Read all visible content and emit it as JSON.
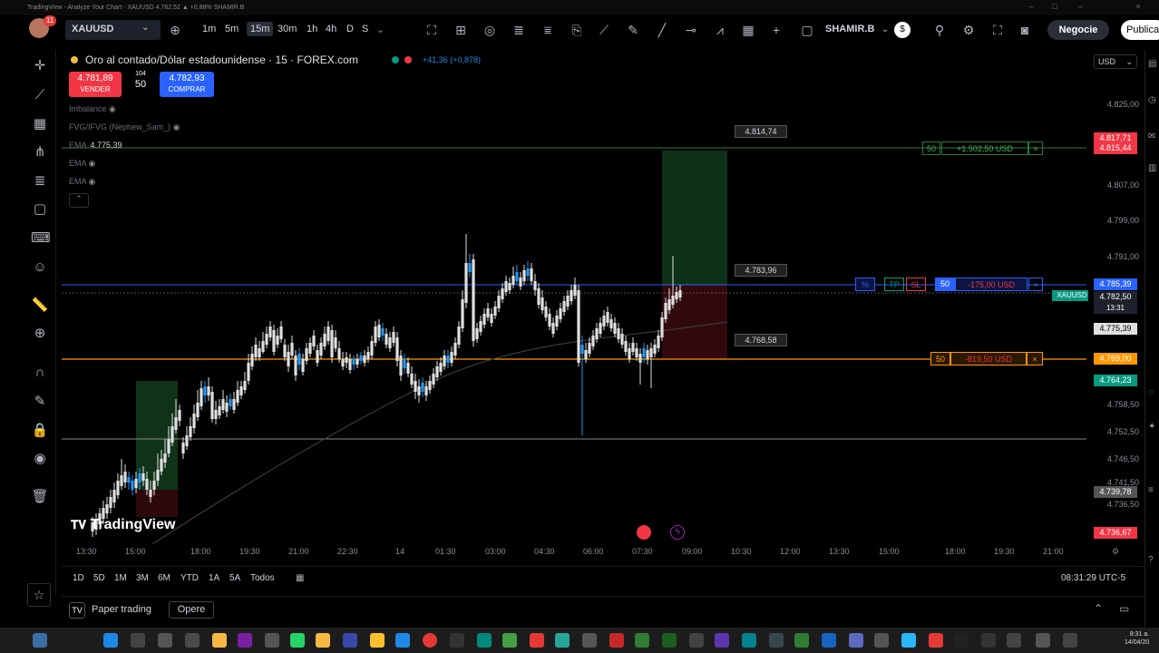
{
  "window": {
    "title": "TradingView - Analyze Your Chart - XAUUSD 4.782,52 ▲ +0,88% SHAMIR.B"
  },
  "topbar": {
    "avatar_badge": "11",
    "symbol": "XAUUSD",
    "timeframes": [
      "1m",
      "5m",
      "15m",
      "30m",
      "1h",
      "4h",
      "D",
      "S"
    ],
    "active_timeframe": "15m",
    "user": "SHAMIR.B",
    "trade_label": "Negocie",
    "publish_label": "Publica"
  },
  "legend": {
    "title": "Oro al contado/Dólar estadounidense · 15 · FOREX.com",
    "change": "+41,36 (+0,878)",
    "sell_price": "4.781,89",
    "sell_label": "VENDER",
    "spread": "104",
    "quantity": "50",
    "buy_price": "4.782,93",
    "buy_label": "COMPRAR",
    "indicators": [
      {
        "name": "Imbalance",
        "value": ""
      },
      {
        "name": "FVG/IFVG (Nephew_Sam_)",
        "value": ""
      },
      {
        "name": "EMA",
        "value": "4.775,39"
      },
      {
        "name": "EMA",
        "value": ""
      },
      {
        "name": "EMA",
        "value": ""
      }
    ]
  },
  "price_axis": {
    "currency": "USD",
    "ticks": [
      "4.825,00",
      "4.807,00",
      "4.799,00",
      "4.791,00",
      "4.758,50",
      "4.752,50",
      "4.746,50",
      "4.741,50",
      "4.736,50"
    ],
    "tags": [
      {
        "text": "4.817,71",
        "color": "#f23645"
      },
      {
        "text": "4.815,44",
        "color": "#f23645"
      },
      {
        "text": "4.785,39",
        "color": "#2962ff"
      },
      {
        "text": "4.782,50",
        "color": "#1e222d"
      },
      {
        "text": "13:31",
        "color": "#1e222d"
      },
      {
        "text": "4.775,39",
        "color": "#e0e0e0"
      },
      {
        "text": "4.769,00",
        "color": "#ff9800"
      },
      {
        "text": "4.764,23",
        "color": "#089981"
      },
      {
        "text": "4.739,78",
        "color": "#555555"
      },
      {
        "text": "4.736,67",
        "color": "#f23645"
      }
    ],
    "symbol_tag": "XAUUSD"
  },
  "position": {
    "target_label": "4.814,74",
    "entry_label": "4.783,96",
    "stop_label": "4.768,58",
    "tp_line": {
      "qty": "50",
      "text": "+1.502,50 USD"
    },
    "entry_line": {
      "qty": "50",
      "text": "-175,00 USD",
      "tp": "TP",
      "sl": "SL",
      "pct": "%"
    },
    "sl_line": {
      "qty": "50",
      "text": "-819,50 USD"
    }
  },
  "time_axis": {
    "ticks": [
      "13:30",
      "15:00",
      "18:00",
      "19:30",
      "21:00",
      "22:30",
      "14",
      "01:30",
      "03:00",
      "04:30",
      "06:00",
      "07:30",
      "09:00",
      "10:30",
      "12:00",
      "13:30",
      "15:00",
      "18:00",
      "19:30",
      "21:00"
    ]
  },
  "range_bar": {
    "ranges": [
      "1D",
      "5D",
      "1M",
      "3M",
      "6M",
      "YTD",
      "1A",
      "5A",
      "Todos"
    ],
    "clock": "08:31:29 UTC-5"
  },
  "bottom_panel": {
    "paper_trading": "Paper trading",
    "open_label": "Opere"
  },
  "branding": {
    "logo_text": "TradingView"
  },
  "taskbar": {
    "time": "8:31 a.",
    "date": "14/04/20"
  },
  "candles": [
    [
      100,
      576,
      586,
      570,
      592
    ],
    [
      104,
      572,
      584,
      566,
      590
    ],
    [
      108,
      566,
      578,
      560,
      584
    ],
    [
      112,
      560,
      572,
      552,
      578
    ],
    [
      116,
      556,
      566,
      548,
      572
    ],
    [
      120,
      548,
      560,
      540,
      566
    ],
    [
      124,
      540,
      554,
      532,
      560
    ],
    [
      128,
      530,
      546,
      522,
      550
    ],
    [
      132,
      524,
      536,
      506,
      540
    ],
    [
      136,
      520,
      532,
      512,
      538
    ],
    [
      140,
      532,
      526,
      520,
      540
    ],
    [
      144,
      540,
      530,
      524,
      546
    ],
    [
      148,
      528,
      538,
      520,
      544
    ],
    [
      152,
      532,
      522,
      516,
      540
    ],
    [
      156,
      522,
      530,
      514,
      536
    ],
    [
      160,
      528,
      540,
      520,
      546
    ],
    [
      164,
      540,
      548,
      530,
      554
    ],
    [
      168,
      530,
      540,
      520,
      546
    ],
    [
      172,
      518,
      530,
      500,
      536
    ],
    [
      176,
      506,
      520,
      496,
      524
    ],
    [
      180,
      500,
      510,
      484,
      516
    ],
    [
      184,
      484,
      500,
      470,
      504
    ],
    [
      188,
      470,
      488,
      456,
      492
    ],
    [
      192,
      460,
      474,
      440,
      478
    ],
    [
      196,
      452,
      464,
      446,
      470
    ],
    [
      200,
      488,
      500,
      482,
      506
    ],
    [
      204,
      480,
      492,
      470,
      496
    ],
    [
      208,
      470,
      482,
      460,
      486
    ],
    [
      212,
      456,
      472,
      446,
      478
    ],
    [
      216,
      444,
      460,
      430,
      464
    ],
    [
      220,
      428,
      448,
      420,
      452
    ],
    [
      224,
      436,
      426,
      420,
      444
    ],
    [
      228,
      426,
      436,
      416,
      442
    ],
    [
      232,
      432,
      462,
      426,
      466
    ],
    [
      236,
      452,
      462,
      442,
      468
    ],
    [
      240,
      448,
      458,
      440,
      462
    ],
    [
      244,
      440,
      452,
      430,
      456
    ],
    [
      248,
      444,
      454,
      436,
      460
    ],
    [
      252,
      448,
      440,
      434,
      452
    ],
    [
      256,
      440,
      452,
      432,
      456
    ],
    [
      260,
      430,
      444,
      420,
      448
    ],
    [
      264,
      426,
      436,
      420,
      440
    ],
    [
      268,
      420,
      430,
      410,
      434
    ],
    [
      272,
      400,
      420,
      390,
      424
    ],
    [
      276,
      390,
      404,
      382,
      408
    ],
    [
      280,
      380,
      394,
      372,
      398
    ],
    [
      284,
      384,
      394,
      376,
      398
    ],
    [
      288,
      376,
      388,
      366,
      390
    ],
    [
      292,
      368,
      380,
      360,
      384
    ],
    [
      296,
      360,
      372,
      354,
      376
    ],
    [
      300,
      364,
      388,
      358,
      392
    ],
    [
      304,
      370,
      380,
      362,
      384
    ],
    [
      308,
      360,
      374,
      354,
      378
    ],
    [
      312,
      380,
      394,
      374,
      398
    ],
    [
      316,
      388,
      404,
      380,
      410
    ],
    [
      320,
      378,
      392,
      370,
      396
    ],
    [
      324,
      392,
      414,
      386,
      420
    ],
    [
      328,
      402,
      390,
      384,
      408
    ],
    [
      332,
      396,
      410,
      390,
      414
    ],
    [
      336,
      384,
      398,
      378,
      402
    ],
    [
      340,
      378,
      390,
      372,
      394
    ],
    [
      344,
      370,
      382,
      364,
      386
    ],
    [
      348,
      386,
      400,
      380,
      404
    ],
    [
      352,
      378,
      392,
      372,
      396
    ],
    [
      356,
      368,
      382,
      360,
      386
    ],
    [
      360,
      360,
      376,
      354,
      380
    ],
    [
      364,
      364,
      394,
      358,
      400
    ],
    [
      368,
      372,
      384,
      364,
      388
    ],
    [
      372,
      384,
      396,
      376,
      400
    ],
    [
      376,
      396,
      404,
      388,
      408
    ],
    [
      380,
      394,
      400,
      388,
      406
    ],
    [
      384,
      396,
      408,
      390,
      412
    ],
    [
      388,
      402,
      396,
      392,
      408
    ],
    [
      392,
      396,
      402,
      390,
      406
    ],
    [
      396,
      398,
      392,
      388,
      402
    ],
    [
      400,
      392,
      400,
      386,
      404
    ],
    [
      404,
      388,
      396,
      382,
      400
    ],
    [
      408,
      376,
      392,
      370,
      396
    ],
    [
      412,
      360,
      378,
      354,
      382
    ],
    [
      416,
      358,
      372,
      352,
      376
    ],
    [
      420,
      370,
      362,
      356,
      376
    ],
    [
      424,
      368,
      380,
      362,
      384
    ],
    [
      428,
      372,
      384,
      366,
      388
    ],
    [
      432,
      366,
      378,
      360,
      382
    ],
    [
      436,
      372,
      398,
      366,
      404
    ],
    [
      440,
      392,
      414,
      386,
      420
    ],
    [
      444,
      406,
      396,
      390,
      412
    ],
    [
      448,
      400,
      412,
      394,
      416
    ],
    [
      452,
      412,
      424,
      404,
      428
    ],
    [
      456,
      420,
      432,
      412,
      440
    ],
    [
      460,
      426,
      436,
      418,
      444
    ],
    [
      464,
      432,
      422,
      416,
      438
    ],
    [
      468,
      426,
      436,
      420,
      442
    ],
    [
      472,
      420,
      430,
      414,
      434
    ],
    [
      476,
      412,
      424,
      406,
      428
    ],
    [
      480,
      404,
      416,
      398,
      420
    ],
    [
      484,
      400,
      410,
      394,
      414
    ],
    [
      488,
      392,
      404,
      386,
      408
    ],
    [
      492,
      400,
      392,
      386,
      406
    ],
    [
      496,
      388,
      400,
      382,
      404
    ],
    [
      500,
      378,
      392,
      372,
      396
    ],
    [
      504,
      360,
      380,
      354,
      384
    ],
    [
      508,
      330,
      362,
      320,
      366
    ],
    [
      512,
      290,
      334,
      258,
      340
    ],
    [
      516,
      300,
      290,
      280,
      306
    ],
    [
      520,
      286,
      376,
      280,
      382
    ],
    [
      524,
      362,
      374,
      356,
      378
    ],
    [
      528,
      354,
      366,
      348,
      370
    ],
    [
      532,
      346,
      358,
      340,
      362
    ],
    [
      536,
      340,
      350,
      334,
      354
    ],
    [
      540,
      346,
      356,
      340,
      360
    ],
    [
      544,
      338,
      348,
      332,
      352
    ],
    [
      548,
      326,
      340,
      320,
      344
    ],
    [
      552,
      318,
      330,
      312,
      334
    ],
    [
      556,
      310,
      322,
      304,
      326
    ],
    [
      560,
      312,
      320,
      306,
      324
    ],
    [
      564,
      304,
      314,
      294,
      318
    ],
    [
      568,
      310,
      300,
      292,
      314
    ],
    [
      572,
      306,
      316,
      300,
      320
    ],
    [
      576,
      298,
      310,
      292,
      314
    ],
    [
      580,
      304,
      296,
      288,
      310
    ],
    [
      584,
      296,
      310,
      290,
      314
    ],
    [
      588,
      310,
      320,
      302,
      326
    ],
    [
      592,
      318,
      336,
      312,
      340
    ],
    [
      596,
      328,
      342,
      320,
      346
    ],
    [
      600,
      338,
      350,
      332,
      354
    ],
    [
      604,
      346,
      360,
      340,
      364
    ],
    [
      608,
      356,
      368,
      350,
      372
    ],
    [
      612,
      348,
      360,
      342,
      364
    ],
    [
      616,
      340,
      352,
      334,
      356
    ],
    [
      620,
      332,
      344,
      326,
      348
    ],
    [
      624,
      326,
      338,
      320,
      342
    ],
    [
      628,
      320,
      332,
      314,
      336
    ],
    [
      632,
      314,
      326,
      306,
      330
    ],
    [
      636,
      320,
      400,
      314,
      404
    ],
    [
      640,
      390,
      380,
      370,
      480
    ],
    [
      644,
      386,
      396,
      378,
      400
    ],
    [
      648,
      378,
      390,
      372,
      394
    ],
    [
      652,
      370,
      382,
      364,
      386
    ],
    [
      656,
      362,
      374,
      356,
      378
    ],
    [
      660,
      356,
      368,
      350,
      372
    ],
    [
      664,
      348,
      360,
      342,
      364
    ],
    [
      668,
      344,
      356,
      338,
      360
    ],
    [
      672,
      352,
      362,
      346,
      366
    ],
    [
      676,
      356,
      368,
      350,
      372
    ],
    [
      680,
      362,
      374,
      356,
      378
    ],
    [
      684,
      368,
      380,
      362,
      384
    ],
    [
      688,
      376,
      388,
      370,
      392
    ],
    [
      692,
      384,
      396,
      378,
      400
    ],
    [
      696,
      378,
      388,
      372,
      392
    ],
    [
      700,
      384,
      394,
      378,
      398
    ],
    [
      704,
      390,
      400,
      384,
      424
    ],
    [
      708,
      394,
      384,
      378,
      400
    ],
    [
      712,
      386,
      396,
      380,
      402
    ],
    [
      716,
      384,
      394,
      378,
      428
    ],
    [
      720,
      380,
      390,
      374,
      394
    ],
    [
      724,
      370,
      384,
      364,
      388
    ],
    [
      728,
      350,
      372,
      344,
      376
    ],
    [
      732,
      334,
      352,
      328,
      356
    ],
    [
      736,
      330,
      342,
      318,
      346
    ],
    [
      740,
      326,
      336,
      282,
      340
    ],
    [
      744,
      322,
      330,
      316,
      334
    ],
    [
      748,
      320,
      328,
      314,
      332
    ]
  ]
}
